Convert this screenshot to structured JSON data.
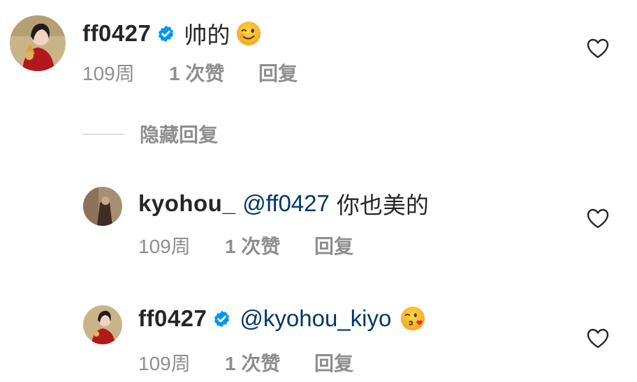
{
  "comments": [
    {
      "username": "ff0427",
      "verified": true,
      "text": "帅的",
      "mention": "",
      "emoji": "winking-face",
      "time": "109周",
      "likes": "1 次赞",
      "reply": "回复"
    },
    {
      "username": "kyohou_",
      "verified": false,
      "mention": "@ff0427",
      "text": "你也美的",
      "time": "109周",
      "likes": "1 次赞",
      "reply": "回复"
    },
    {
      "username": "ff0427",
      "verified": true,
      "mention": "@kyohou_kiyo",
      "text": "",
      "emoji": "face-blowing-kiss",
      "time": "109周",
      "likes": "1 次赞",
      "reply": "回复"
    }
  ],
  "hide_replies": "隐藏回复",
  "colors": {
    "text": "#262626",
    "secondary": "#8e8e8e",
    "mention": "#00376b",
    "verified": "#0095f6"
  }
}
